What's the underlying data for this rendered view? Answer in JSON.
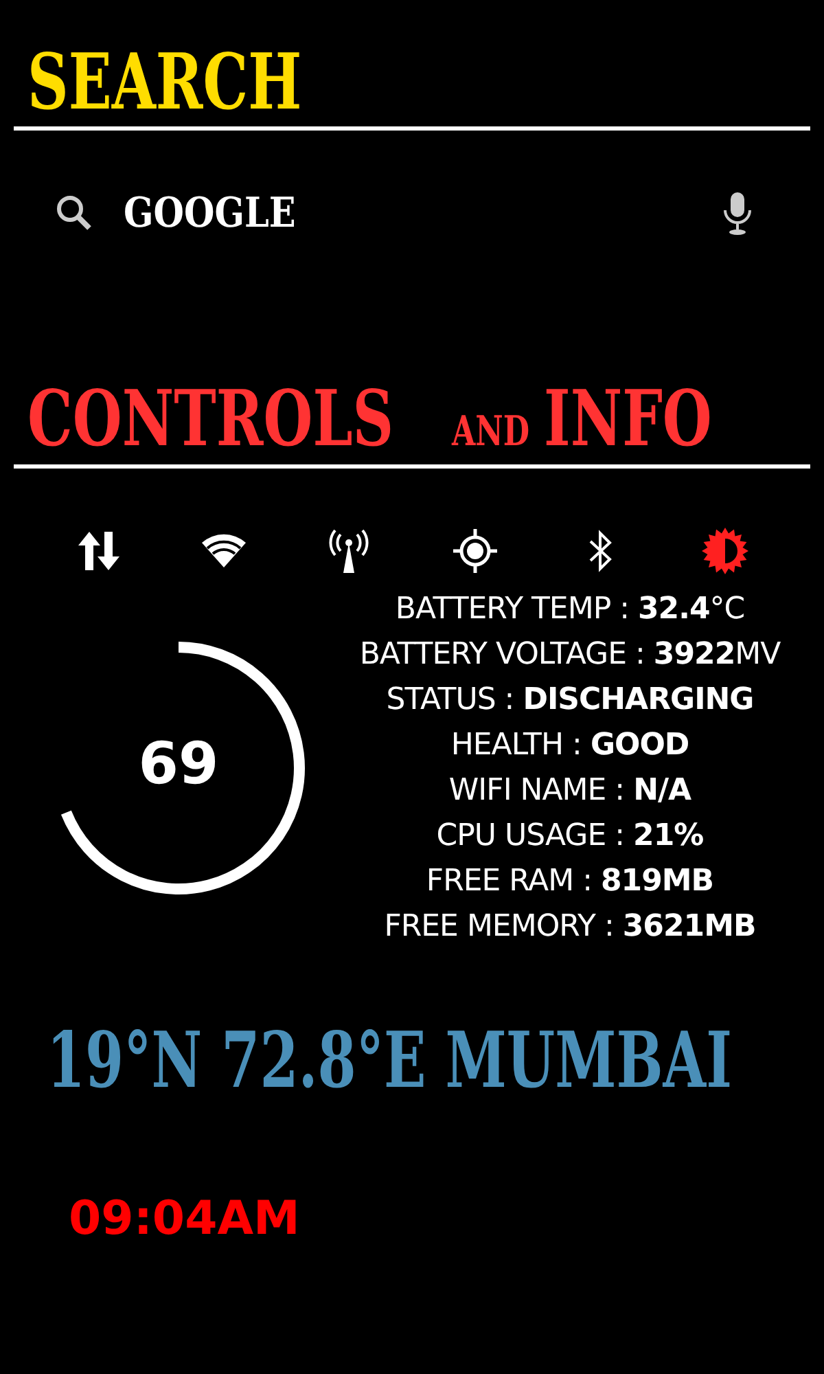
{
  "search_section": {
    "title": "SEARCH",
    "query_label": "GOOGLE"
  },
  "controls_section": {
    "title_parts": [
      {
        "text": "CONTROLS",
        "kind": "big"
      },
      {
        "text": "AND",
        "kind": "small"
      },
      {
        "text": "INFO",
        "kind": "big"
      }
    ],
    "toggles": [
      {
        "kind": "data",
        "on": false
      },
      {
        "kind": "wifi",
        "on": false
      },
      {
        "kind": "signal",
        "on": false
      },
      {
        "kind": "location",
        "on": false
      },
      {
        "kind": "bluetooth",
        "on": false
      },
      {
        "kind": "brightness",
        "on": true
      }
    ],
    "battery": {
      "reading": "69"
    },
    "info": [
      "BATTERY TEMP : **32.4**°C",
      "BATTERY VOLTAGE : **3922**MV",
      "STATUS : **DISCHARGING**",
      "HEALTH : **GOOD**",
      "WIFI NAME : **N/A**",
      "CPU USAGE : **21%**",
      "FREE RAM : **819MB**",
      "FREE MEMORY : **3621MB**"
    ]
  },
  "location": "19°N 72.8°E MUMBAI",
  "time": "09:04AM"
}
